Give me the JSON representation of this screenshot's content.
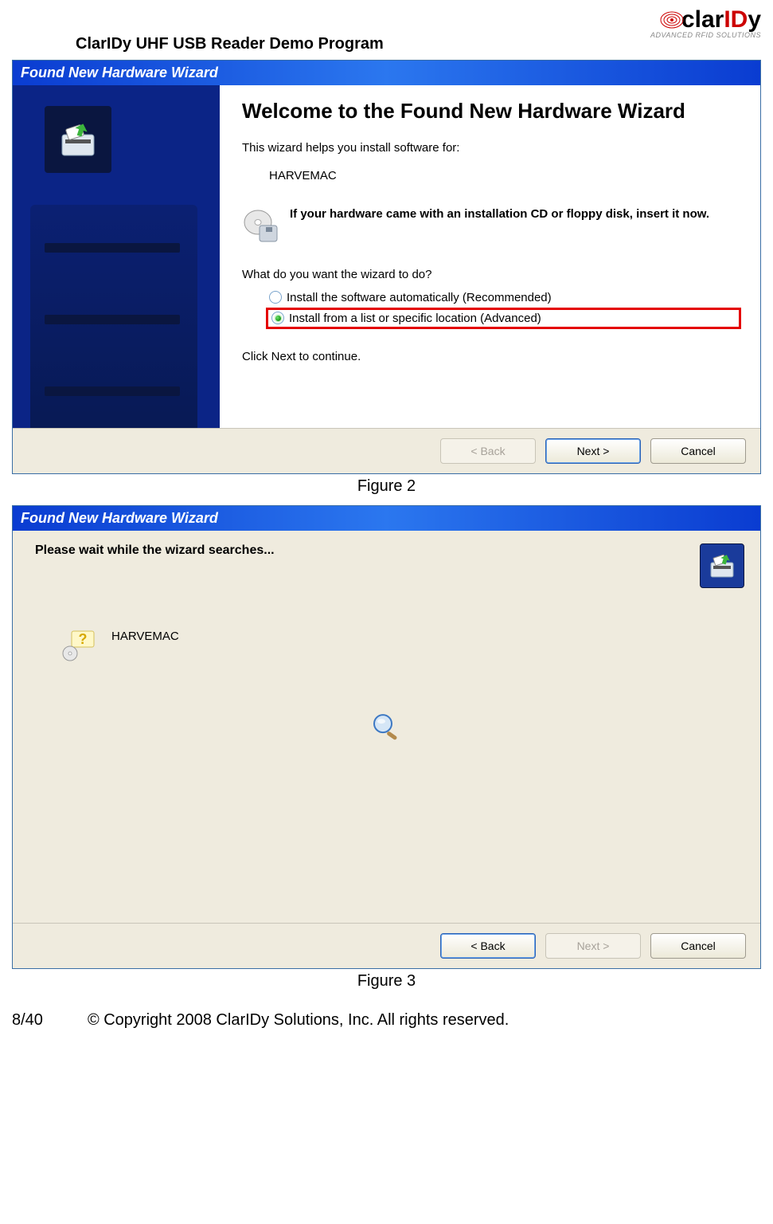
{
  "header": {
    "doc_title": "ClarIDy UHF USB Reader Demo Program",
    "logo_main": "clarIDy",
    "logo_sub": "ADVANCED RFID SOLUTIONS"
  },
  "wizard1": {
    "titlebar": "Found New Hardware Wizard",
    "welcome": "Welcome to the Found New Hardware Wizard",
    "help_text": "This wizard helps you install software for:",
    "device": "HARVEMAC",
    "cd_text": "If your hardware came with an installation CD or floppy disk, insert it now.",
    "question": "What do you want the wizard to do?",
    "options": [
      {
        "label": "Install the software automatically (Recommended)",
        "selected": false,
        "highlight": false
      },
      {
        "label": "Install from a list or specific location (Advanced)",
        "selected": true,
        "highlight": true
      }
    ],
    "click_next": "Click Next to continue.",
    "buttons": {
      "back": "< Back",
      "next": "Next >",
      "cancel": "Cancel"
    }
  },
  "caption1": "Figure 2",
  "wizard2": {
    "titlebar": "Found New Hardware Wizard",
    "heading": "Please wait while the wizard searches...",
    "device": "HARVEMAC",
    "buttons": {
      "back": "< Back",
      "next": "Next >",
      "cancel": "Cancel"
    }
  },
  "caption2": "Figure 3",
  "footer": {
    "page": "8/40",
    "copyright": "© Copyright 2008 ClarIDy Solutions, Inc. All rights reserved."
  }
}
